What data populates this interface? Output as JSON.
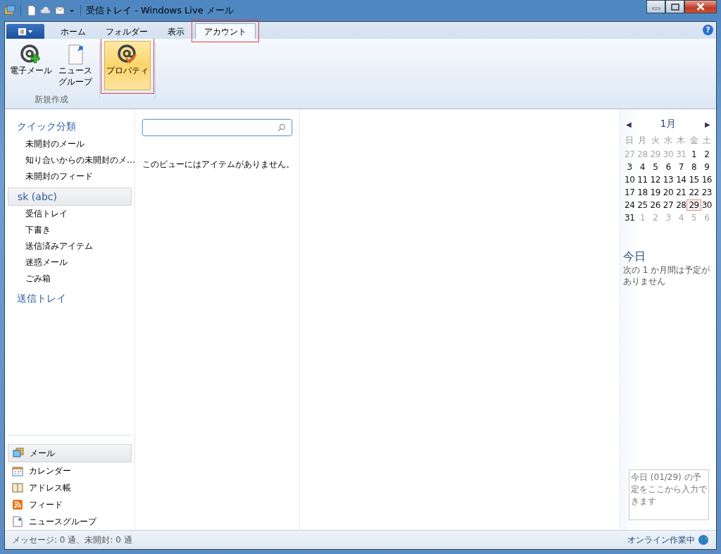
{
  "window": {
    "title": "受信トレイ - Windows Live メール"
  },
  "help": "?",
  "ribbon_tabs": [
    {
      "label": "ホーム",
      "selected": false,
      "highlighted": false
    },
    {
      "label": "フォルダー",
      "selected": false,
      "highlighted": false
    },
    {
      "label": "表示",
      "selected": false,
      "highlighted": false
    },
    {
      "label": "アカウント",
      "selected": true,
      "highlighted": true
    }
  ],
  "ribbon_groups": [
    {
      "label": "新規作成",
      "buttons": [
        {
          "kind": "email",
          "lines": [
            "電子メール"
          ],
          "highlighted": false
        },
        {
          "kind": "newsgroup",
          "lines": [
            "ニュース",
            "グループ"
          ],
          "highlighted": false
        }
      ]
    },
    {
      "buttons": [
        {
          "kind": "properties",
          "lines": [
            "プロパティ"
          ],
          "highlighted": true
        }
      ]
    }
  ],
  "sidebar": {
    "sections": [
      {
        "title": "クイック分類",
        "selected": false,
        "items": [
          "未開封のメール",
          "知り合いからの未開封のメ…",
          "未開封のフィード"
        ]
      },
      {
        "title": "sk (abc)",
        "selected": true,
        "items": [
          "受信トレイ",
          "下書き",
          "送信済みアイテム",
          "迷惑メール",
          "ごみ箱"
        ]
      },
      {
        "title": "送信トレイ",
        "selected": false
      }
    ],
    "nav": [
      {
        "kind": "mail",
        "label": "メール",
        "selected": true
      },
      {
        "kind": "calendar",
        "label": "カレンダー",
        "selected": false
      },
      {
        "kind": "contacts",
        "label": "アドレス帳",
        "selected": false
      },
      {
        "kind": "feed",
        "label": "フィード",
        "selected": false
      },
      {
        "kind": "newsgroup",
        "label": "ニュースグループ",
        "selected": false
      }
    ]
  },
  "message_list": {
    "empty_text": "このビューにはアイテムがありません。"
  },
  "calendar": {
    "prev": "◀",
    "month": "1月",
    "next": "▶",
    "weekdays": [
      "日",
      "月",
      "火",
      "水",
      "木",
      "金",
      "土"
    ],
    "weeks": [
      [
        {
          "d": "27",
          "other": true,
          "today": false
        },
        {
          "d": "28",
          "other": true,
          "today": false
        },
        {
          "d": "29",
          "other": true,
          "today": false
        },
        {
          "d": "30",
          "other": true,
          "today": false
        },
        {
          "d": "31",
          "other": true,
          "today": false
        },
        {
          "d": "1",
          "other": false,
          "today": false
        },
        {
          "d": "2",
          "other": false,
          "today": false
        }
      ],
      [
        {
          "d": "3",
          "other": false,
          "today": false
        },
        {
          "d": "4",
          "other": false,
          "today": false
        },
        {
          "d": "5",
          "other": false,
          "today": false
        },
        {
          "d": "6",
          "other": false,
          "today": false
        },
        {
          "d": "7",
          "other": false,
          "today": false
        },
        {
          "d": "8",
          "other": false,
          "today": false
        },
        {
          "d": "9",
          "other": false,
          "today": false
        }
      ],
      [
        {
          "d": "10",
          "other": false,
          "today": false
        },
        {
          "d": "11",
          "other": false,
          "today": false
        },
        {
          "d": "12",
          "other": false,
          "today": false
        },
        {
          "d": "13",
          "other": false,
          "today": false
        },
        {
          "d": "14",
          "other": false,
          "today": false
        },
        {
          "d": "15",
          "other": false,
          "today": false
        },
        {
          "d": "16",
          "other": false,
          "today": false
        }
      ],
      [
        {
          "d": "17",
          "other": false,
          "today": false
        },
        {
          "d": "18",
          "other": false,
          "today": false
        },
        {
          "d": "19",
          "other": false,
          "today": false
        },
        {
          "d": "20",
          "other": false,
          "today": false
        },
        {
          "d": "21",
          "other": false,
          "today": false
        },
        {
          "d": "22",
          "other": false,
          "today": false
        },
        {
          "d": "23",
          "other": false,
          "today": false
        }
      ],
      [
        {
          "d": "24",
          "other": false,
          "today": false
        },
        {
          "d": "25",
          "other": false,
          "today": false
        },
        {
          "d": "26",
          "other": false,
          "today": false
        },
        {
          "d": "27",
          "other": false,
          "today": false
        },
        {
          "d": "28",
          "other": false,
          "today": false
        },
        {
          "d": "29",
          "other": false,
          "today": true
        },
        {
          "d": "30",
          "other": false,
          "today": false
        }
      ],
      [
        {
          "d": "31",
          "other": false,
          "today": false
        },
        {
          "d": "1",
          "other": true,
          "today": false
        },
        {
          "d": "2",
          "other": true,
          "today": false
        },
        {
          "d": "3",
          "other": true,
          "today": false
        },
        {
          "d": "4",
          "other": true,
          "today": false
        },
        {
          "d": "5",
          "other": true,
          "today": false
        },
        {
          "d": "6",
          "other": true,
          "today": false
        }
      ]
    ],
    "today_title": "今日",
    "today_text": "次の 1 か月間は予定がありません",
    "entry_placeholder": "今日 (01/29) の予定をここから入力できます"
  },
  "status_bar": {
    "left": "メッセージ: 0 通、未開封: 0 通",
    "right": "オンライン作業中"
  }
}
